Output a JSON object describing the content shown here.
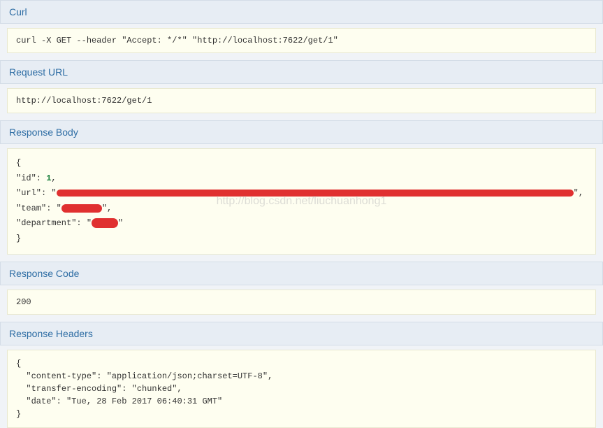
{
  "sections": {
    "curl": {
      "title": "Curl",
      "content": "curl -X GET --header \"Accept: */*\" \"http://localhost:7622/get/1\""
    },
    "requestUrl": {
      "title": "Request URL",
      "content": "http://localhost:7622/get/1"
    },
    "responseBody": {
      "title": "Response Body",
      "json": {
        "open": "{",
        "idKey": "  \"id\": ",
        "idValue": "1",
        "idComma": ",",
        "urlKey": "  \"url\": ",
        "urlQuote1": "\"",
        "urlQuote2": "\"",
        "urlComma": ",",
        "teamKey": "  \"team\": ",
        "teamQuote1": "\"",
        "teamQuote2": "\"",
        "teamComma": ",",
        "deptKey": "  \"department\": ",
        "deptQuote1": "\"",
        "deptQuote2": "\"",
        "close": "}"
      }
    },
    "responseCode": {
      "title": "Response Code",
      "content": "200"
    },
    "responseHeaders": {
      "title": "Response Headers",
      "content": "{\n  \"content-type\": \"application/json;charset=UTF-8\",\n  \"transfer-encoding\": \"chunked\",\n  \"date\": \"Tue, 28 Feb 2017 06:40:31 GMT\"\n}"
    }
  },
  "watermark": "http://blog.csdn.net/liuchuanhong1"
}
